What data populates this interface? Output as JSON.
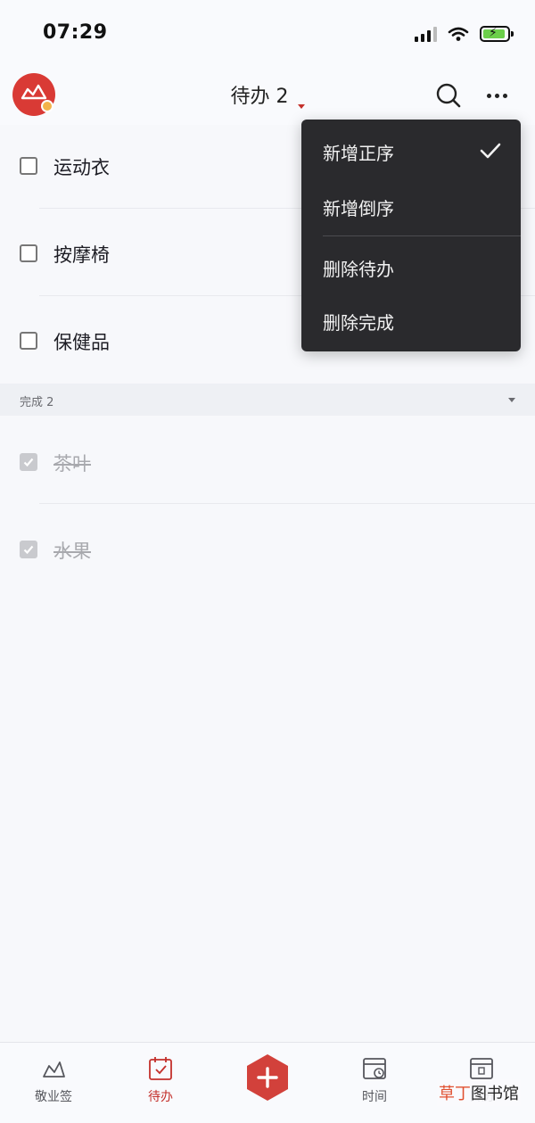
{
  "status_bar": {
    "time": "07:29"
  },
  "header": {
    "title": "待办 2"
  },
  "todo_items": [
    {
      "label": "运动衣"
    },
    {
      "label": "按摩椅"
    },
    {
      "label": "保健品"
    }
  ],
  "completed_section": {
    "label": "完成 2"
  },
  "completed_items": [
    {
      "label": "茶叶"
    },
    {
      "label": "水果"
    }
  ],
  "sort_menu": {
    "items": [
      {
        "label": "新增正序",
        "checked": true
      },
      {
        "label": "新增倒序",
        "checked": false
      },
      {
        "label": "删除待办"
      },
      {
        "label": "删除完成"
      }
    ]
  },
  "tab_bar": {
    "tabs": [
      {
        "label": "敬业签",
        "icon": "note-icon",
        "active": false
      },
      {
        "label": "待办",
        "icon": "todo-calendar-icon",
        "active": true
      },
      {
        "label": "",
        "icon": "add-hexagon-icon"
      },
      {
        "label": "时间",
        "icon": "time-calendar-icon",
        "active": false
      },
      {
        "label": "日历",
        "icon": "calendar-icon",
        "active": false
      }
    ]
  },
  "watermark": {
    "part1": "草丁",
    "part2": "图书馆"
  },
  "colors": {
    "brand_red": "#c4302b",
    "menu_bg": "#2a2a2d",
    "background": "#f7f8fb"
  }
}
